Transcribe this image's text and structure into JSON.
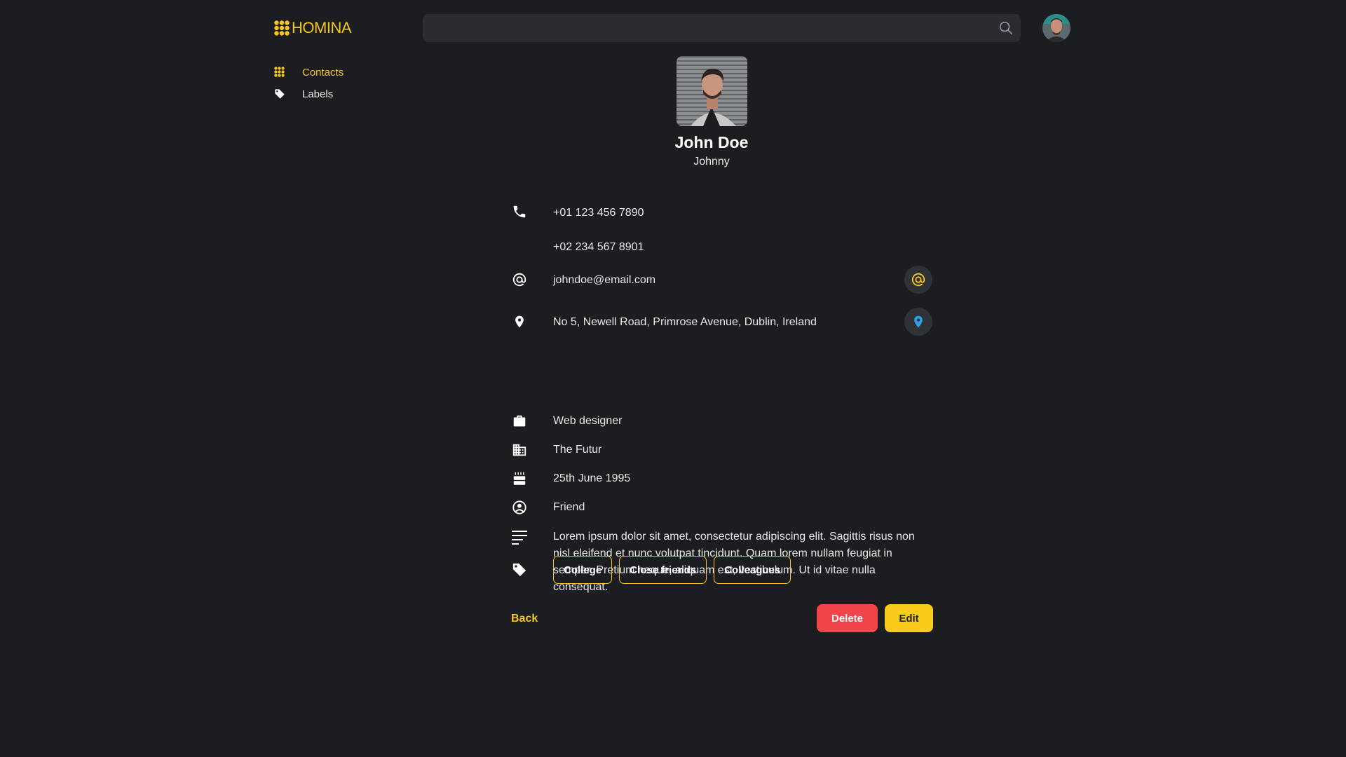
{
  "app": {
    "logo_text": "HOMINA",
    "accent_color": "#f5c518",
    "logo_icon": "grid-dots-icon"
  },
  "header": {
    "search_placeholder": "",
    "search_icon": "search-icon",
    "avatar_icon": "user-avatar"
  },
  "sidebar": {
    "items": [
      {
        "label": "Contacts",
        "icon": "grid-dots-icon",
        "active": true
      },
      {
        "label": "Labels",
        "icon": "tag-icon",
        "active": false
      }
    ]
  },
  "contact": {
    "name": "John Doe",
    "nickname": "Johnny",
    "phones": [
      "+01 123 456 7890",
      "+02 234 567 8901"
    ],
    "email": "johndoe@email.com",
    "address": "No 5, Newell Road, Primrose Avenue, Dublin, Ireland",
    "job_title": "Web designer",
    "company": "The Futur",
    "birthday": "25th June 1995",
    "relationship": "Friend",
    "notes": "Lorem ipsum dolor sit amet, consectetur adipiscing elit. Sagittis risus non nisl eleifend et nunc volutpat tincidunt. Quam lorem nullam feugiat in semper. Pretium neque, aliquam est, vestibulum. Ut id vitae nulla consequat.",
    "labels": [
      "College",
      "Close friends",
      "Colleagues"
    ]
  },
  "actions": {
    "back_label": "Back",
    "delete_label": "Delete",
    "edit_label": "Edit",
    "delete_color": "#f1434a",
    "edit_color": "#f9cc1c",
    "map_pin_color": "#2f9fe8"
  }
}
